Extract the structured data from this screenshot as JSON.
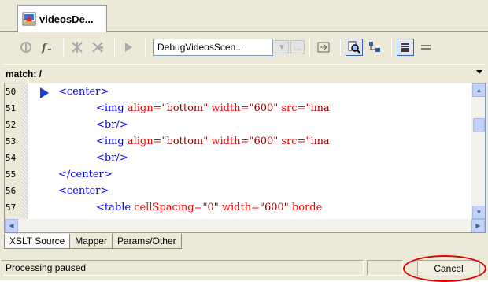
{
  "doc_tab": {
    "label": "videosDe..."
  },
  "toolbar": {
    "scenario_value": "DebugVideosScen...",
    "icons": [
      "debug-step-icon",
      "function-icon",
      "step-into-icon",
      "step-out-icon",
      "run-icon",
      "dropdown-arrow-icon",
      "ellipsis-icon",
      "assign-icon",
      "find-icon",
      "tree-icon",
      "indent-icon",
      "lines-icon"
    ]
  },
  "matchbar": {
    "label": "match: /"
  },
  "editor": {
    "lines": [
      {
        "num": "50",
        "code": "<center>"
      },
      {
        "num": "51",
        "code": "<img align=\"bottom\" width=\"600\" src=\"ima"
      },
      {
        "num": "52",
        "code": "<br/>"
      },
      {
        "num": "53",
        "code": "<img align=\"bottom\" width=\"600\" src=\"ima"
      },
      {
        "num": "54",
        "code": "<br/>"
      },
      {
        "num": "55",
        "code": "</center>"
      },
      {
        "num": "56",
        "code": "<center>"
      },
      {
        "num": "57",
        "code": "<table cellSpacing=\"0\" width=\"600\" borde"
      }
    ]
  },
  "bottom_tabs": [
    "XSLT Source",
    "Mapper",
    "Params/Other"
  ],
  "status": {
    "text": "Processing paused",
    "cancel_label": "Cancel"
  },
  "colors": {
    "annotation_ring": "#e00000",
    "tag": "#0000ff",
    "attr_name": "#ff0000",
    "attr_value": "#8b0000"
  }
}
